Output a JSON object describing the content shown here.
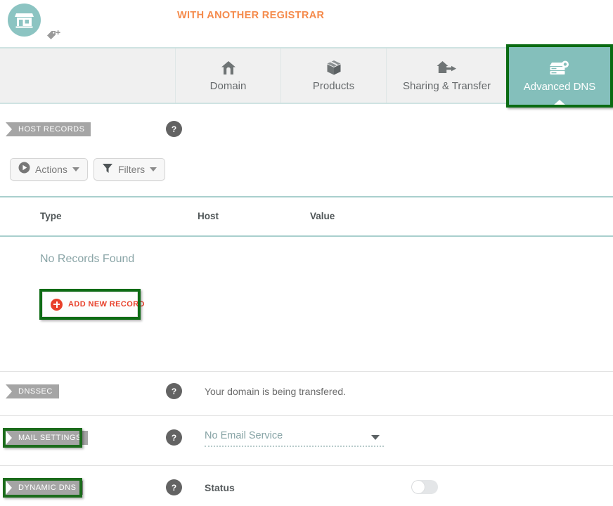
{
  "header": {
    "registrar_title": "WITH ANOTHER REGISTRAR",
    "avatar_icon": "storefront-icon",
    "tag_icon": "tag-plus-icon"
  },
  "tabs": [
    {
      "label": "Domain",
      "icon": "home-icon",
      "active": false
    },
    {
      "label": "Products",
      "icon": "box-icon",
      "active": false
    },
    {
      "label": "Sharing & Transfer",
      "icon": "home-transfer-icon",
      "active": false
    },
    {
      "label": "Advanced DNS",
      "icon": "server-icon",
      "active": true
    }
  ],
  "host_records": {
    "section_label": "HOST RECORDS",
    "help_label": "?",
    "actions_button": "Actions",
    "filters_button": "Filters",
    "columns": [
      "Type",
      "Host",
      "Value"
    ],
    "rows": [],
    "empty_message": "No Records Found",
    "add_record_label": "ADD NEW RECORD"
  },
  "dnssec": {
    "section_label": "DNSSEC",
    "help_label": "?",
    "message": "Your domain is being transfered."
  },
  "mail_settings": {
    "section_label": "MAIL SETTINGS",
    "help_label": "?",
    "selected_option": "No Email Service"
  },
  "dynamic_dns": {
    "section_label": "DYNAMIC DNS",
    "help_label": "?",
    "status_label": "Status",
    "status_enabled": false
  },
  "colors": {
    "accent_teal": "#84bfbb",
    "accent_orange": "#f58b4c",
    "annotation_green": "#0d6b14",
    "ribbon_grey": "#a5a5a5",
    "add_record_red": "#e8402a",
    "rule_teal": "#a9cfcd"
  }
}
